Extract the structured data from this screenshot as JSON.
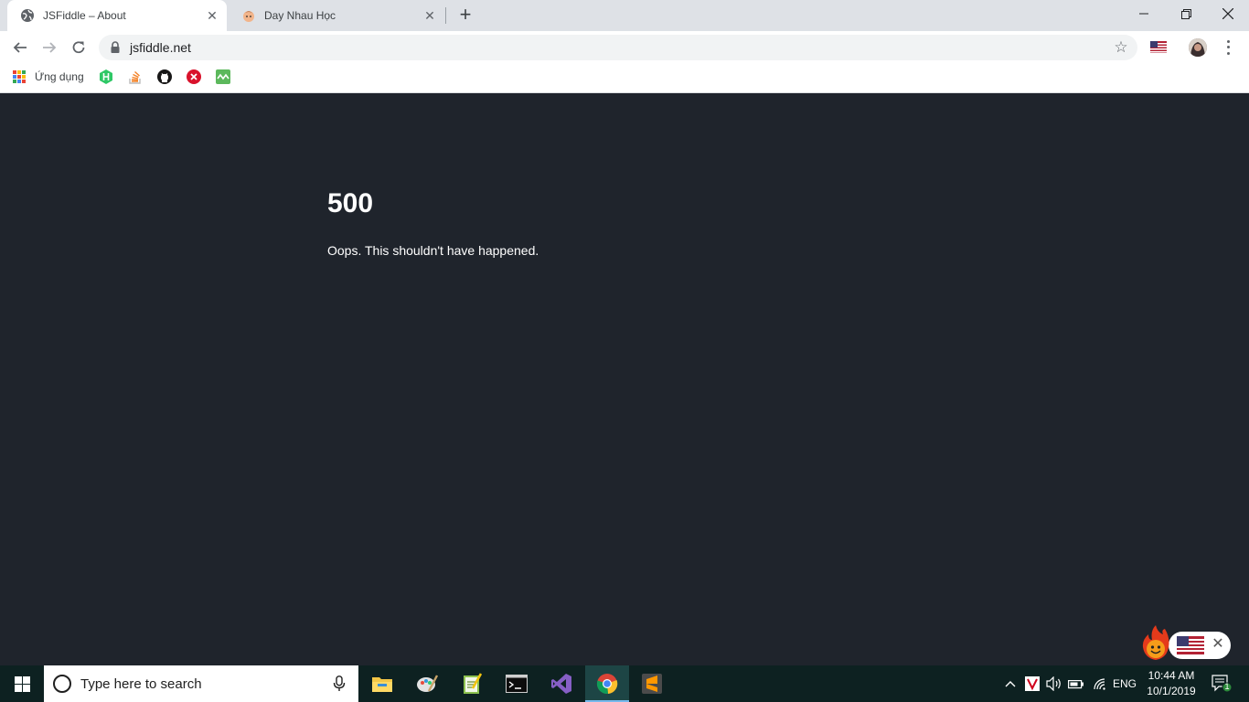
{
  "browser": {
    "tabs": [
      {
        "title": "JSFiddle – About",
        "favicon": "globe-icon",
        "active": true
      },
      {
        "title": "Day Nhau Học",
        "favicon": "face-avatar-icon",
        "active": false
      }
    ],
    "url": "jsfiddle.net",
    "bookmarks": {
      "apps_label": "Ứng dụng",
      "items": [
        "hackerrank-icon",
        "stackoverflow-icon",
        "github-icon",
        "x-icon",
        "codepen-icon"
      ]
    }
  },
  "page": {
    "error_code": "500",
    "error_message": "Oops. This shouldn't have happened."
  },
  "taskbar": {
    "search_placeholder": "Type here to search",
    "apps": [
      "file-explorer-icon",
      "paint-icon",
      "notepad-icon",
      "terminal-icon",
      "visual-studio-icon",
      "chrome-icon",
      "sublime-icon"
    ],
    "active_app": "chrome-icon",
    "language": "ENG",
    "time": "10:44 AM",
    "date": "10/1/2019",
    "notifications": "1"
  },
  "colors": {
    "page_bg": "#1f242c",
    "taskbar_bg": "#0d2121",
    "tabstrip_bg": "#dee1e6"
  }
}
